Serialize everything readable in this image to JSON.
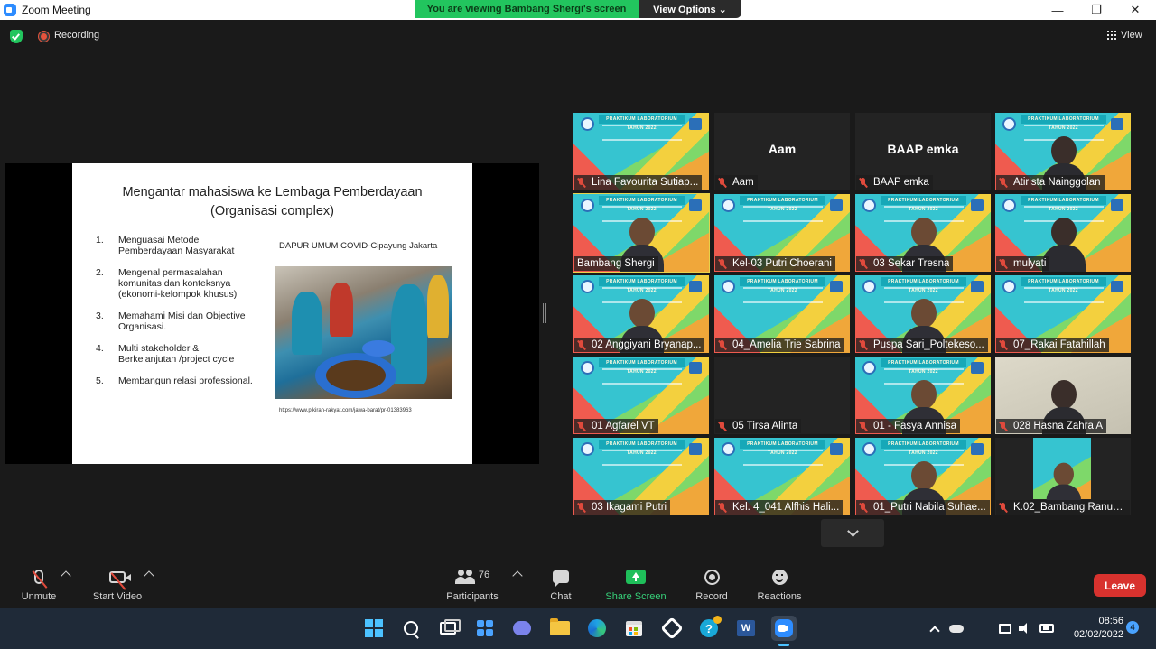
{
  "window": {
    "title": "Zoom Meeting",
    "minimize_glyph": "—",
    "maximize_glyph": "❐",
    "close_glyph": "✕"
  },
  "banner": {
    "viewing_text": "You are viewing Bambang Shergi's screen",
    "view_options_label": "View Options ⌄"
  },
  "status": {
    "recording_label": "Recording",
    "view_label": "View"
  },
  "slide": {
    "title": "Mengantar mahasiswa ke Lembaga Pemberdayaan\n(Organisasi complex)",
    "items": [
      {
        "num": "1.",
        "text": "Menguasai Metode\nPemberdayaan Masyarakat"
      },
      {
        "num": "2.",
        "text": "Mengenal  permasalahan\nkomunitas dan konteksnya\n(ekonomi-kelompok khusus)"
      },
      {
        "num": "3.",
        "text": "Memahami Misi dan Objective\nOrganisasi."
      },
      {
        "num": "4.",
        "text": "Multi stakeholder &\nBerkelanjutan /project cycle"
      },
      {
        "num": "5.",
        "text": "Membangun relasi professional."
      }
    ],
    "photo_caption": "DAPUR UMUM COVID-Cipayung Jakarta",
    "source_url": "https://www.pikiran-rakyat.com/jawa-barat/pr-01383963"
  },
  "participants": [
    {
      "name": "Lina Favourita Sutiap...",
      "video": "banner",
      "muted": true
    },
    {
      "name": "Aam",
      "video": "none",
      "center_label": "Aam",
      "muted": true
    },
    {
      "name": "BAAP emka",
      "video": "none",
      "center_label": "BAAP emka",
      "muted": true
    },
    {
      "name": "Atirista Nainggolan",
      "video": "banner-person",
      "muted": true
    },
    {
      "name": "Bambang Shergi",
      "video": "banner-person",
      "muted": false,
      "active": true
    },
    {
      "name": "Kel-03 Putri Choerani",
      "video": "banner",
      "muted": true
    },
    {
      "name": "03 Sekar Tresna",
      "video": "banner-person",
      "muted": true
    },
    {
      "name": "mulyati",
      "video": "banner-person",
      "muted": true
    },
    {
      "name": "02 Anggiyani Bryanap...",
      "video": "banner-person",
      "muted": true
    },
    {
      "name": "04_Amelia Trie Sabrina",
      "video": "banner",
      "muted": true
    },
    {
      "name": "Puspa Sari_Poltekeso...",
      "video": "banner-person",
      "muted": true
    },
    {
      "name": "07_Rakai Fatahillah",
      "video": "banner",
      "muted": true
    },
    {
      "name": "01 Agfarel VT",
      "video": "banner",
      "muted": true
    },
    {
      "name": "05 Tirsa Alinta",
      "video": "none",
      "muted": true
    },
    {
      "name": "01 - Fasya Annisa",
      "video": "banner-person",
      "muted": true
    },
    {
      "name": "028 Hasna Zahra A",
      "video": "camera",
      "muted": true
    },
    {
      "name": "03 Ikagami Putri",
      "video": "banner",
      "muted": true
    },
    {
      "name": "Kel. 4_041 Alfhis Hali...",
      "video": "banner",
      "muted": true
    },
    {
      "name": "01_Putri Nabila Suhae...",
      "video": "banner-person",
      "muted": true
    },
    {
      "name": "K.02_Bambang Ranus...",
      "video": "screen-thumb",
      "muted": true
    }
  ],
  "toolbar": {
    "unmute_label": "Unmute",
    "start_video_label": "Start Video",
    "participants_label": "Participants",
    "participants_count": "76",
    "chat_label": "Chat",
    "share_screen_label": "Share Screen",
    "record_label": "Record",
    "reactions_label": "Reactions",
    "leave_label": "Leave"
  },
  "tile_banner_text": "PRAKTIKUM LABORATORIUM TAHUN 2022",
  "taskbar": {
    "word_glyph": "W",
    "help_glyph": "?",
    "time": "08:56",
    "date": "02/02/2022",
    "notification_count": "4"
  },
  "colors": {
    "accent_green": "#22c55e",
    "leave_red": "#d8322e",
    "zoom_blue": "#2d8cff",
    "muted_red": "#e04a3c"
  }
}
